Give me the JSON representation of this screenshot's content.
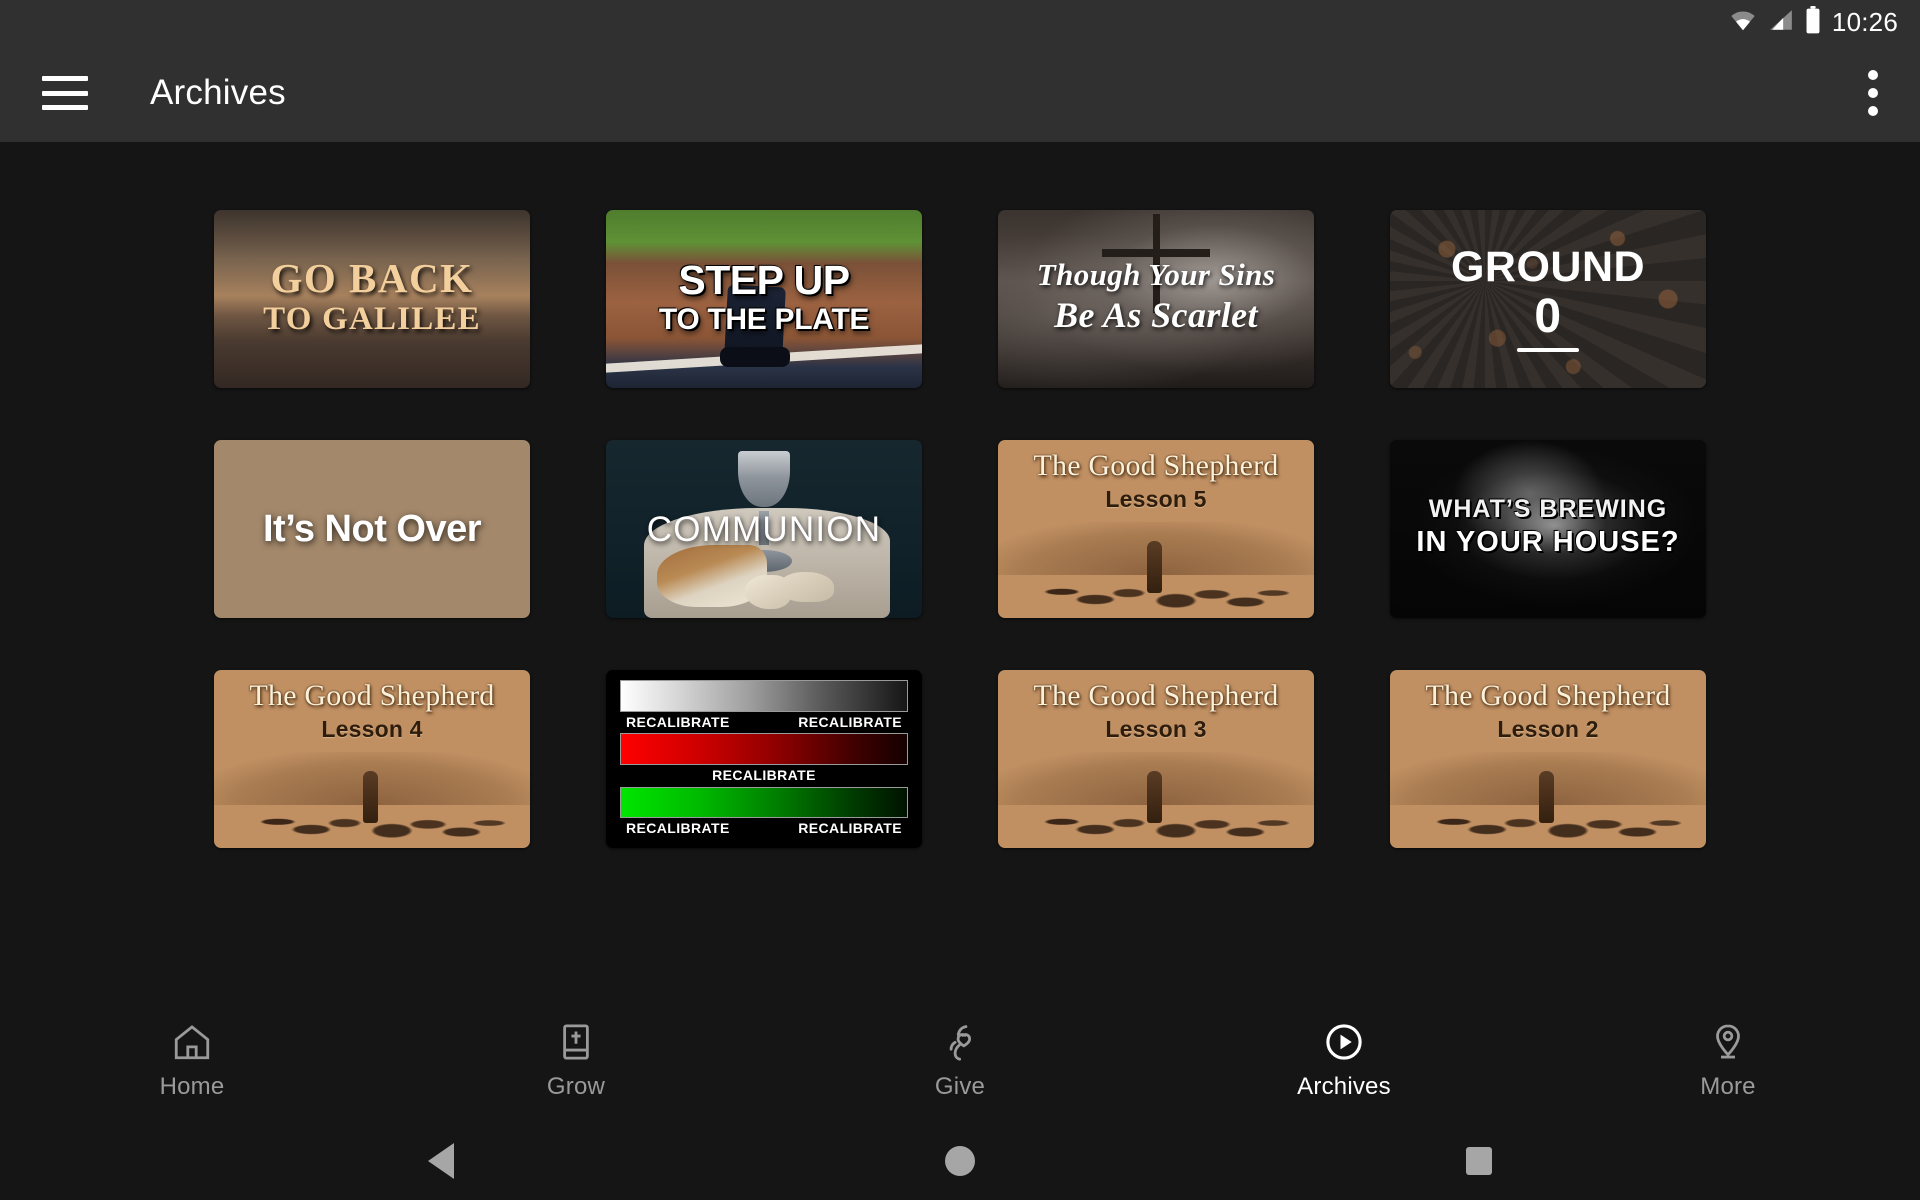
{
  "status_bar": {
    "time": "10:26",
    "icons": [
      "wifi-icon",
      "cellular-signal-icon",
      "battery-icon"
    ]
  },
  "app_bar": {
    "menu_icon": "hamburger-menu-icon",
    "title": "Archives",
    "overflow_icon": "more-vertical-icon"
  },
  "theme": {
    "background": "#151515",
    "app_bar_background": "#303030",
    "accent_text": "#ffffff",
    "inactive_text": "#9a9a9a"
  },
  "grid": {
    "columns": 4,
    "items": [
      {
        "id": "go-back-to-galilee",
        "title": "GO BACK TO GALILEE",
        "line1": "GO BACK",
        "line2": "TO GALILEE",
        "artwork": "sunset-over-water-with-cross-silhouette"
      },
      {
        "id": "step-up-to-the-plate",
        "title": "STEP UP TO THE PLATE",
        "line1": "STEP UP",
        "line2": "TO THE PLATE",
        "artwork": "baseball-home-plate-with-player-legs"
      },
      {
        "id": "though-your-sins-be-as-scarlet",
        "title": "Though Your Sins Be As Scarlet",
        "line1": "Though Your Sins",
        "line2": "Be As Scarlet",
        "artwork": "cross-silhouette-in-stormy-clouds"
      },
      {
        "id": "ground-0",
        "title": "GROUND 0",
        "line1": "GROUND",
        "line2": "0",
        "artwork": "asphalt-gravel-with-fallen-leaves"
      },
      {
        "id": "its-not-over",
        "title": "It's Not Over",
        "line1": "It’s Not Over",
        "line2": "",
        "artwork": "empty-tomb-with-rolled-stone"
      },
      {
        "id": "communion",
        "title": "COMMUNION",
        "line1": "COMMUNION",
        "line2": "",
        "artwork": "silver-chalice-and-broken-bread-on-cloth"
      },
      {
        "id": "the-good-shepherd-lesson-5",
        "title": "The Good Shepherd Lesson 5",
        "line1": "The Good Shepherd",
        "line2": "Lesson 5",
        "artwork": "sepia-shepherd-walking-with-flock"
      },
      {
        "id": "whats-brewing-in-your-house",
        "title": "WHAT'S BREWING IN YOUR HOUSE?",
        "line1": "WHAT’S BREWING",
        "line2": "IN YOUR HOUSE?",
        "artwork": "smoky-brain-on-black-background"
      },
      {
        "id": "the-good-shepherd-lesson-4",
        "title": "The Good Shepherd Lesson 4",
        "line1": "The Good Shepherd",
        "line2": "Lesson 4",
        "artwork": "sepia-shepherd-walking-with-flock"
      },
      {
        "id": "recalibrate",
        "title": "RECALIBRATE",
        "line1": "RECALIBRATE",
        "line2": "RECALIBRATE",
        "line3": "RECALIBRATE",
        "artwork": "color-calibration-gradient-bars"
      },
      {
        "id": "the-good-shepherd-lesson-3",
        "title": "The Good Shepherd Lesson 3",
        "line1": "The Good Shepherd",
        "line2": "Lesson 3",
        "artwork": "sepia-shepherd-walking-with-flock"
      },
      {
        "id": "the-good-shepherd-lesson-2",
        "title": "The Good Shepherd Lesson 2",
        "line1": "The Good Shepherd",
        "line2": "Lesson 2",
        "artwork": "sepia-shepherd-walking-with-flock"
      }
    ]
  },
  "tab_bar": {
    "active": "Archives",
    "tabs": [
      {
        "label": "Home",
        "icon": "home-icon"
      },
      {
        "label": "Grow",
        "icon": "bible-book-icon"
      },
      {
        "label": "Give",
        "icon": "giving-hand-heart-icon"
      },
      {
        "label": "Archives",
        "icon": "play-circle-icon"
      },
      {
        "label": "More",
        "icon": "location-pin-icon"
      }
    ]
  },
  "nav_bar": {
    "back": "back-triangle-icon",
    "home": "home-circle-icon",
    "recents": "recents-square-icon"
  }
}
